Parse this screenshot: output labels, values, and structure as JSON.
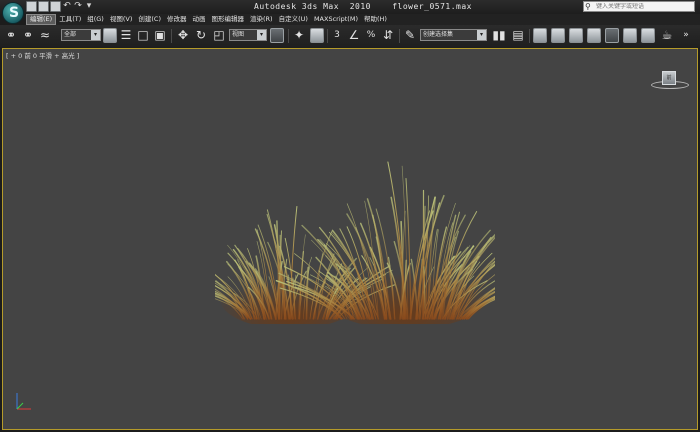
{
  "title_bar": {
    "app_title": "Autodesk 3ds Max  2010    flower_0571.max",
    "help_search_placeholder": "键入关键字或短语"
  },
  "logo": {
    "glyph": "S"
  },
  "quick_access": [
    "new",
    "open",
    "save",
    "undo",
    "redo",
    "dropdown"
  ],
  "menu": [
    {
      "label": "编辑(E)",
      "active": true
    },
    {
      "label": "工具(T)"
    },
    {
      "label": "组(G)"
    },
    {
      "label": "视图(V)"
    },
    {
      "label": "创建(C)"
    },
    {
      "label": "修改器"
    },
    {
      "label": "动画"
    },
    {
      "label": "图形编辑器"
    },
    {
      "label": "渲染(R)"
    },
    {
      "label": "自定义(U)"
    },
    {
      "label": "MAXScript(M)"
    },
    {
      "label": "帮助(H)"
    }
  ],
  "toolbar": {
    "selection_filter": "全部",
    "reference_coord": "视图",
    "named_selection_set": "创建选择集",
    "snap_label": "3"
  },
  "viewport": {
    "label": "[ + 0 前 0 平滑 + 高光 ]",
    "border_color": "#b59b2a",
    "background": "#444444",
    "viewcube_face": "前"
  },
  "icons": [
    "search-icon",
    "select-icon",
    "move-icon",
    "rotate-icon",
    "scale-icon",
    "mirror-icon",
    "align-icon",
    "render-icon",
    "teapot-icon"
  ]
}
